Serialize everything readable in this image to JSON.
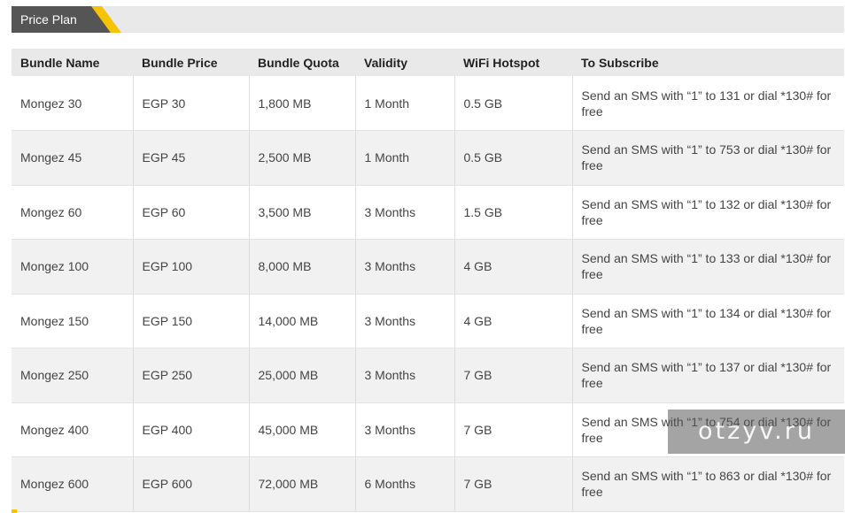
{
  "header": {
    "tab_label": "Price Plan",
    "accent_color": "#f5c400"
  },
  "table": {
    "columns": [
      "Bundle Name",
      "Bundle Price",
      "Bundle Quota",
      "Validity",
      "WiFi Hotspot",
      "To Subscribe"
    ],
    "rows": [
      [
        "Mongez 30",
        "EGP 30",
        "1,800 MB",
        "1 Month",
        "0.5 GB",
        "Send an SMS with “1” to 131 or dial *130# for free"
      ],
      [
        "Mongez 45",
        "EGP 45",
        "2,500 MB",
        "1 Month",
        "0.5 GB",
        "Send an SMS with “1” to 753 or dial *130# for free"
      ],
      [
        "Mongez 60",
        "EGP 60",
        "3,500 MB",
        "3 Months",
        "1.5 GB",
        "Send an SMS with “1” to 132 or dial *130# for free"
      ],
      [
        "Mongez 100",
        "EGP 100",
        "8,000 MB",
        "3 Months",
        "4 GB",
        "Send an SMS with “1” to 133 or dial *130# for free"
      ],
      [
        "Mongez 150",
        "EGP 150",
        "14,000 MB",
        "3 Months",
        "4 GB",
        "Send an SMS with “1” to 134 or dial *130# for free"
      ],
      [
        "Mongez 250",
        "EGP 250",
        "25,000 MB",
        "3 Months",
        "7 GB",
        "Send an SMS with “1” to 137 or dial *130# for free"
      ],
      [
        "Mongez 400",
        "EGP 400",
        "45,000 MB",
        "3 Months",
        "7 GB",
        "Send an SMS with “1” to 754 or dial *130# for free"
      ],
      [
        "Mongez 600",
        "EGP 600",
        "72,000 MB",
        "6 Months",
        "7 GB",
        "Send an SMS with “1” to 863 or dial *130# for free"
      ]
    ]
  },
  "watermark": {
    "text": "otzyv.ru"
  }
}
